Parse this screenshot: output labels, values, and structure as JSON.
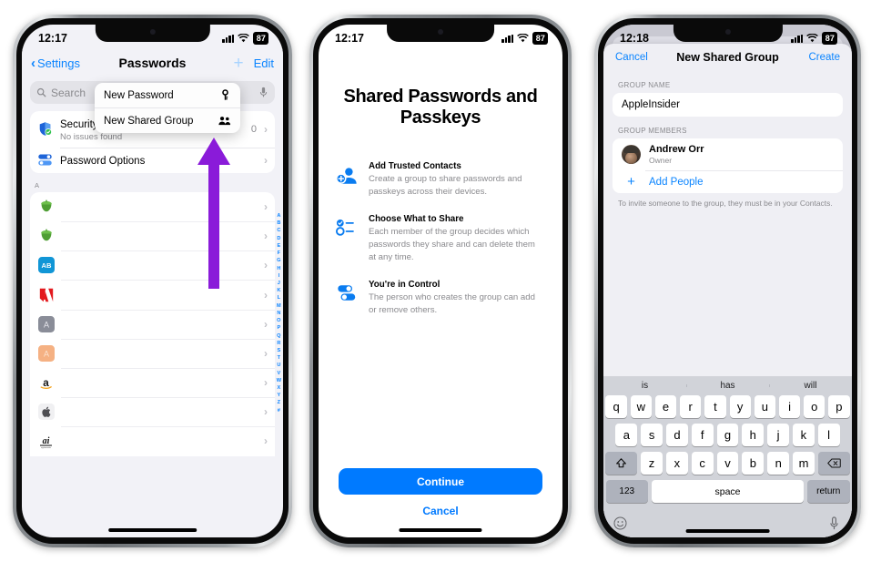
{
  "phone1": {
    "status": {
      "time": "12:17",
      "battery": "87",
      "signal_icon": "cellular-bars-icon",
      "wifi_icon": "wifi-icon"
    },
    "nav": {
      "back_label": "Settings",
      "title": "Passwords",
      "add_label": "+",
      "edit_label": "Edit"
    },
    "search": {
      "placeholder": "Search",
      "search_icon": "search-icon",
      "mic_icon": "microphone-icon"
    },
    "popover": {
      "items": [
        {
          "label": "New Password",
          "icon": "key-icon"
        },
        {
          "label": "New Shared Group",
          "icon": "people-group-icon"
        }
      ]
    },
    "settings_rows": [
      {
        "title": "Security Recommendations",
        "subtitle": "No issues found",
        "count": "0",
        "icon": "shield-check-icon"
      },
      {
        "title": "Password Options",
        "subtitle": "",
        "count": "",
        "icon": "password-options-icon"
      }
    ],
    "section_letter": "A",
    "password_items": [
      {
        "icon": "acorn-green-icon"
      },
      {
        "icon": "acorn-green-icon"
      },
      {
        "icon": "ab-blue-icon"
      },
      {
        "icon": "adobe-red-icon"
      },
      {
        "icon": "letter-a-gray-icon"
      },
      {
        "icon": "letter-a-orange-icon"
      },
      {
        "icon": "amazon-icon"
      },
      {
        "icon": "apple-icon"
      },
      {
        "icon": "appleinsider-icon"
      }
    ],
    "index_letters": [
      "A",
      "B",
      "C",
      "D",
      "E",
      "F",
      "G",
      "H",
      "I",
      "J",
      "K",
      "L",
      "M",
      "N",
      "O",
      "P",
      "Q",
      "R",
      "S",
      "T",
      "U",
      "V",
      "W",
      "X",
      "Y",
      "Z",
      "#"
    ],
    "annotation": {
      "name": "purple-arrow",
      "color": "#8a1bd9"
    }
  },
  "phone2": {
    "status": {
      "time": "12:17",
      "battery": "87"
    },
    "title": "Shared Passwords and Passkeys",
    "features": [
      {
        "icon": "person-add-icon",
        "heading": "Add Trusted Contacts",
        "body": "Create a group to share passwords and passkeys across their devices."
      },
      {
        "icon": "checklist-icon",
        "heading": "Choose What to Share",
        "body": "Each member of the group decides which passwords they share and can delete them at any time."
      },
      {
        "icon": "toggles-icon",
        "heading": "You're in Control",
        "body": "The person who creates the group can add or remove others."
      }
    ],
    "primary_button": "Continue",
    "secondary_button": "Cancel",
    "accent": "#007aff"
  },
  "phone3": {
    "status": {
      "time": "12:18",
      "battery": "87"
    },
    "nav": {
      "cancel": "Cancel",
      "title": "New Shared Group",
      "create": "Create"
    },
    "group_name": {
      "label": "GROUP NAME",
      "value": "AppleInsider"
    },
    "members": {
      "label": "GROUP MEMBERS",
      "person": {
        "name": "Andrew Orr",
        "role": "Owner",
        "avatar": "avatar"
      },
      "add_label": "Add People",
      "add_icon": "plus-icon"
    },
    "note": "To invite someone to the group, they must be in your Contacts.",
    "keyboard": {
      "predictions": [
        "is",
        "has",
        "will"
      ],
      "row1": [
        "q",
        "w",
        "e",
        "r",
        "t",
        "y",
        "u",
        "i",
        "o",
        "p"
      ],
      "row2": [
        "a",
        "s",
        "d",
        "f",
        "g",
        "h",
        "j",
        "k",
        "l"
      ],
      "row3": [
        "z",
        "x",
        "c",
        "v",
        "b",
        "n",
        "m"
      ],
      "shift_icon": "shift-icon",
      "backspace_icon": "backspace-icon",
      "numbers_key": "123",
      "space_key": "space",
      "return_key": "return",
      "emoji_icon": "emoji-icon",
      "dictation_icon": "microphone-icon"
    }
  }
}
